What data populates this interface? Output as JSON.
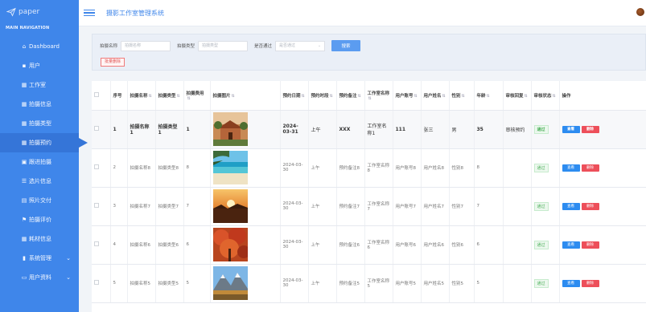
{
  "app": {
    "logo_text": "paper",
    "title": "摄影工作室管理系统"
  },
  "sidebar": {
    "section_title": "MAIN NAVIGATION",
    "items": [
      {
        "label": "Dashboard",
        "icon": "home-icon"
      },
      {
        "label": "用户",
        "icon": "user-icon"
      },
      {
        "label": "工作室",
        "icon": "grid-icon"
      },
      {
        "label": "拍摄信息",
        "icon": "grid-icon"
      },
      {
        "label": "拍摄类型",
        "icon": "grid-icon"
      },
      {
        "label": "拍摄预约",
        "icon": "grid-icon"
      },
      {
        "label": "跟进拍摄",
        "icon": "camera-icon"
      },
      {
        "label": "选片信息",
        "icon": "list-icon"
      },
      {
        "label": "照片交付",
        "icon": "image-icon"
      },
      {
        "label": "拍摄评价",
        "icon": "flag-icon"
      },
      {
        "label": "耗材信息",
        "icon": "grid-icon"
      },
      {
        "label": "系统管理",
        "icon": "bars-icon"
      },
      {
        "label": "用户资料",
        "icon": "card-icon"
      }
    ]
  },
  "search": {
    "name_label": "拍摄名称",
    "name_placeholder": "拍摄名称",
    "type_label": "拍摄类型",
    "type_placeholder": "拍摄类型",
    "approved_label": "是否通过",
    "approved_placeholder": "是否通过",
    "search_button": "搜索",
    "batch_delete_button": "批量删除"
  },
  "table": {
    "headers": [
      "序号",
      "拍摄名称",
      "拍摄类型",
      "拍摄费用",
      "拍摄图片",
      "预约日期",
      "预约时段",
      "预约备注",
      "工作室名称",
      "用户账号",
      "用户姓名",
      "性别",
      "年龄",
      "审核回复",
      "审核状态",
      "操作"
    ],
    "view_label": "查看",
    "delete_label": "删除",
    "rows": [
      {
        "no": "1",
        "name": "拍摄名称1",
        "type": "拍摄类型1",
        "fee": "1",
        "date": "2024-03-31",
        "slot": "上午",
        "remark": "XXX",
        "studio": "工作室名称1",
        "account": "111",
        "username": "张三",
        "gender": "男",
        "age": "35",
        "reply": "审核预约",
        "status": "通过",
        "photo": "house"
      },
      {
        "no": "2",
        "name": "拍摄名称8",
        "type": "拍摄类型8",
        "fee": "8",
        "date": "2024-03-30",
        "slot": "上午",
        "remark": "预约备注8",
        "studio": "工作室名称8",
        "account": "用户账号8",
        "username": "用户姓名8",
        "gender": "性别8",
        "age": "8",
        "reply": "",
        "status": "通过",
        "photo": "beach"
      },
      {
        "no": "3",
        "name": "拍摄名称7",
        "type": "拍摄类型7",
        "fee": "7",
        "date": "2024-03-30",
        "slot": "上午",
        "remark": "预约备注7",
        "studio": "工作室名称7",
        "account": "用户账号7",
        "username": "用户姓名7",
        "gender": "性别7",
        "age": "7",
        "reply": "",
        "status": "通过",
        "photo": "sunset"
      },
      {
        "no": "4",
        "name": "拍摄名称6",
        "type": "拍摄类型6",
        "fee": "6",
        "date": "2024-03-30",
        "slot": "上午",
        "remark": "预约备注6",
        "studio": "工作室名称6",
        "account": "用户账号6",
        "username": "用户姓名6",
        "gender": "性别6",
        "age": "6",
        "reply": "",
        "status": "通过",
        "photo": "autumn"
      },
      {
        "no": "5",
        "name": "拍摄名称5",
        "type": "拍摄类型5",
        "fee": "5",
        "date": "2024-03-30",
        "slot": "上午",
        "remark": "预约备注5",
        "studio": "工作室名称5",
        "account": "用户账号5",
        "username": "用户姓名5",
        "gender": "性别5",
        "age": "5",
        "reply": "",
        "status": "通过",
        "photo": "mountain"
      }
    ]
  },
  "colors": {
    "sidebar": "#3f86ea",
    "accent": "#2d8cf0",
    "danger": "#ed4f5a",
    "success": "#4caf5a"
  }
}
